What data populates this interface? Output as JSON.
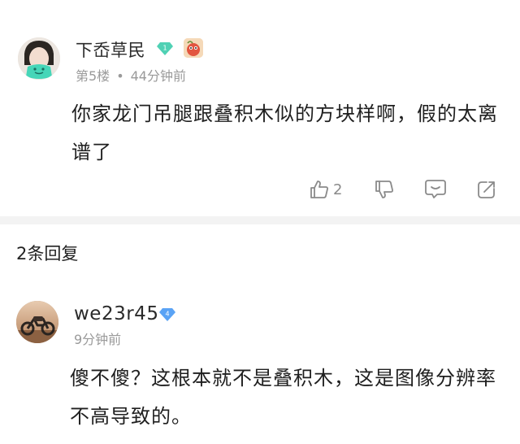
{
  "main_comment": {
    "username": "下岙草民",
    "level": "1",
    "floor": "第5楼",
    "separator_dot": "•",
    "time": "44分钟前",
    "content": "你家龙门吊腿跟叠积木似的方块样啊，假的太离谱了",
    "like_count": "2",
    "icons": [
      "thumbs-up-icon",
      "thumbs-down-icon",
      "comment-icon",
      "share-icon"
    ]
  },
  "replies": {
    "header": "2条回复",
    "items": [
      {
        "username": "we23r45",
        "level": "4",
        "time": "9分钟前",
        "content": "傻不傻？这根本就不是叠积木，这是图像分辨率不高导致的。"
      }
    ]
  },
  "colors": {
    "badge_green": "#4fd1b4",
    "badge_blue": "#5aa3f5",
    "muted_text": "#9a9a9a",
    "icon_gray": "#8a8a8a",
    "separator": "#f3f3f3"
  }
}
